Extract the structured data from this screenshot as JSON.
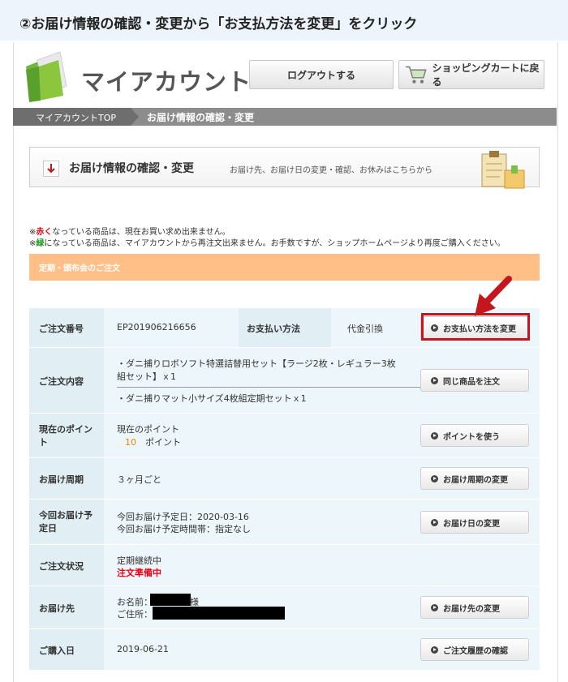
{
  "step_title": "②お届け情報の確認・変更から「お支払方法を変更」をクリック",
  "header": {
    "logo_text": "マイアカウント",
    "logout_label": "ログアウトする",
    "cart_label": "ショッピングカートに戻る"
  },
  "breadcrumb": {
    "item1": "マイアカウントTOP",
    "item2": "お届け情報の確認・変更"
  },
  "section": {
    "title": "お届け情報の確認・変更",
    "desc": "お届け先、お届け日の変更・確認、お休みはこちらから"
  },
  "notices": {
    "n1_prefix": "※",
    "n1_colored": "赤く",
    "n1_rest": "なっている商品は、現在お買い求め出来ません。",
    "n2_prefix": "※",
    "n2_colored": "緑",
    "n2_rest": "になっている商品は、マイアカウントから再注文出来ません。お手数ですが、ショップホームページより再度ご購入ください。"
  },
  "order_band": "定期・頒布会のご注文",
  "rows": {
    "order_no": {
      "label": "ご注文番号",
      "value": "EP201906216656",
      "pay_label": "お支払い方法",
      "pay_value": "代金引換",
      "button": "お支払い方法を変更"
    },
    "contents": {
      "label": "ご注文内容",
      "item1": "・ダニ捕りロボソフト特選詰替用セット【ラージ2枚・レギュラー3枚組セット】ｘ1",
      "item2": "・ダニ捕りマット小サイズ4枚組定期セットｘ1",
      "button": "同じ商品を注文"
    },
    "points": {
      "label": "現在のポイント",
      "line1": "現在のポイント",
      "num": "10",
      "unit": "ポイント",
      "button": "ポイントを使う"
    },
    "cycle": {
      "label": "お届け周期",
      "value": "３ヶ月ごと",
      "button": "お届け周期の変更"
    },
    "next": {
      "label": "今回お届け予定日",
      "line1": "今回お届け予定日：2020-03-16",
      "line2": "今回お届け予定時間帯：指定なし",
      "button": "お届け日の変更"
    },
    "status": {
      "label": "ご注文状況",
      "line1": "定期継続中",
      "line2": "注文準備中"
    },
    "dest": {
      "label": "お届け先",
      "name_label": "お名前：",
      "name_suffix": "様",
      "addr_label": "ご住所：",
      "button": "お届け先の変更"
    },
    "date": {
      "label": "ご購入日",
      "value": "2019-06-21",
      "button": "ご注文履歴の確認"
    }
  },
  "colors": {
    "accent_red": "#c4161c",
    "orange_band": "#ffbf86",
    "row_bg": "#edf6fa",
    "header_cell": "#e1eff5"
  },
  "icons": [
    "folder-logo-icon",
    "cart-icon",
    "down-arrow-icon",
    "clipboard-icon",
    "red-pointer-arrow-icon",
    "play-circle-icon"
  ]
}
